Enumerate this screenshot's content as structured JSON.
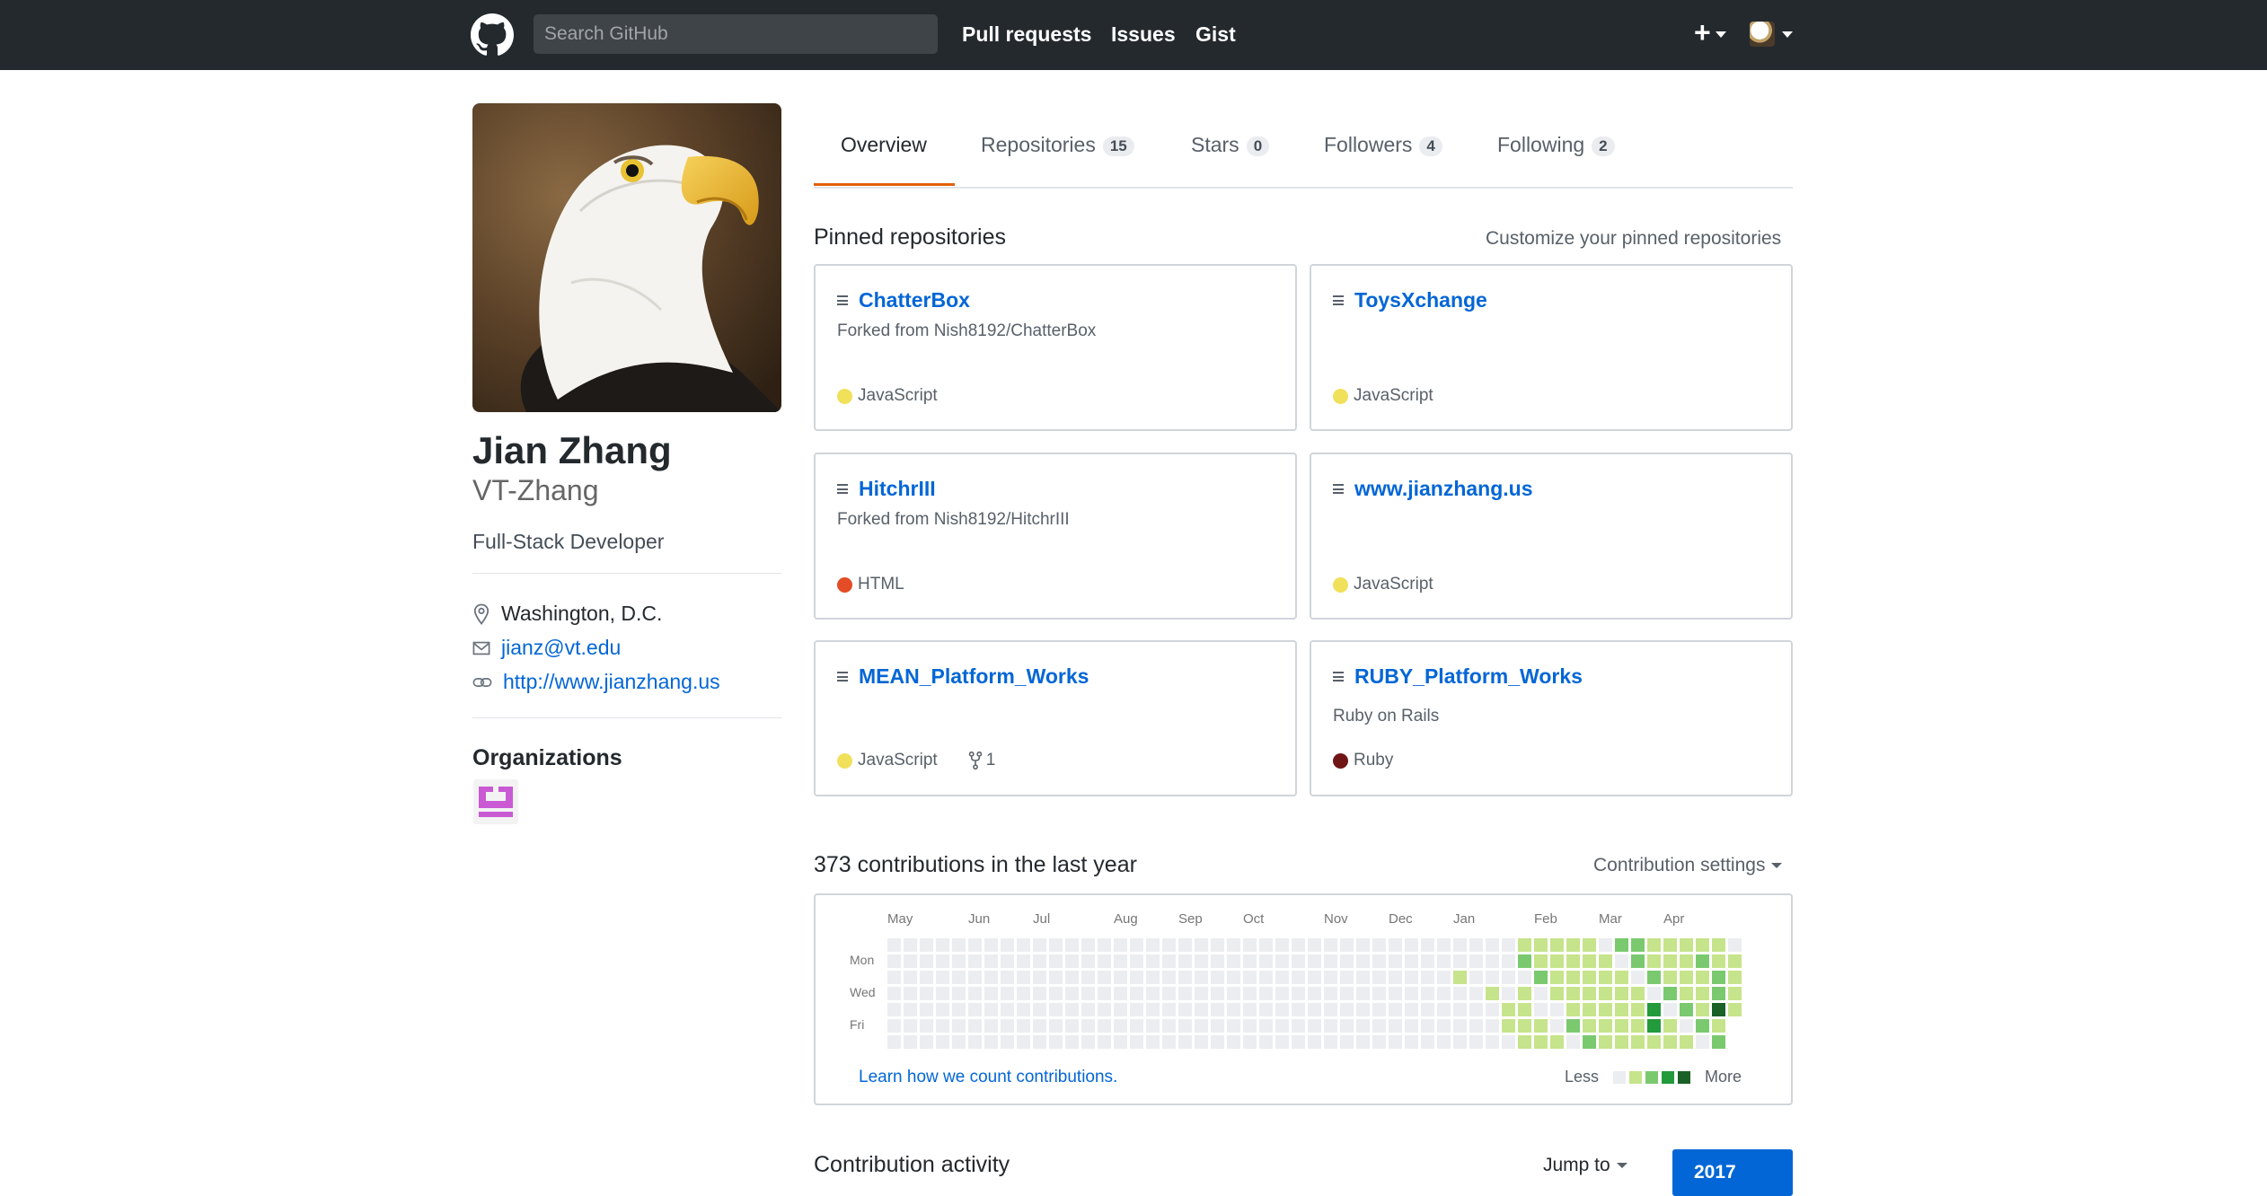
{
  "header": {
    "search_placeholder": "Search GitHub",
    "nav": [
      "Pull requests",
      "Issues",
      "Gist"
    ],
    "new_icon": "plus-icon",
    "colors": {
      "background": "#24292e",
      "text": "#ffffff"
    }
  },
  "profile": {
    "full_name": "Jian Zhang",
    "username": "VT-Zhang",
    "bio": "Full-Stack Developer",
    "location": "Washington, D.C.",
    "email": "jianz@vt.edu",
    "website": "http://www.jianzhang.us",
    "organizations_title": "Organizations"
  },
  "tabs": [
    {
      "label": "Overview",
      "count": null,
      "selected": true
    },
    {
      "label": "Repositories",
      "count": "15"
    },
    {
      "label": "Stars",
      "count": "0"
    },
    {
      "label": "Followers",
      "count": "4"
    },
    {
      "label": "Following",
      "count": "2"
    }
  ],
  "pinned": {
    "title": "Pinned repositories",
    "customize": "Customize your pinned repositories",
    "repos": [
      {
        "name": "ChatterBox",
        "desc": "Forked from Nish8192/ChatterBox",
        "lang": "JavaScript",
        "color": "#f1e05a"
      },
      {
        "name": "ToysXchange",
        "desc": "",
        "lang": "JavaScript",
        "color": "#f1e05a"
      },
      {
        "name": "HitchrIII",
        "desc": "Forked from Nish8192/HitchrIII",
        "lang": "HTML",
        "color": "#e34c26"
      },
      {
        "name": "www.jianzhang.us",
        "desc": "",
        "lang": "JavaScript",
        "color": "#f1e05a"
      },
      {
        "name": "MEAN_Platform_Works",
        "desc": "",
        "lang": "JavaScript",
        "color": "#f1e05a",
        "forks": "1"
      },
      {
        "name": "RUBY_Platform_Works",
        "desc": "Ruby on Rails",
        "lang": "Ruby",
        "color": "#701516"
      }
    ]
  },
  "contributions": {
    "title": "373 contributions in the last year",
    "settings": "Contribution settings",
    "months": [
      "May",
      "Jun",
      "Jul",
      "Aug",
      "Sep",
      "Oct",
      "Nov",
      "Dec",
      "Jan",
      "Feb",
      "Mar",
      "Apr"
    ],
    "days": [
      "Mon",
      "Wed",
      "Fri"
    ],
    "learn": "Learn how we count contributions.",
    "less": "Less",
    "more": "More",
    "palette": [
      "#ebedf0",
      "#c6e48b",
      "#7bc96f",
      "#239a3b",
      "#196127"
    ]
  },
  "activity": {
    "title": "Contribution activity",
    "jump": "Jump to",
    "year": "2017"
  }
}
